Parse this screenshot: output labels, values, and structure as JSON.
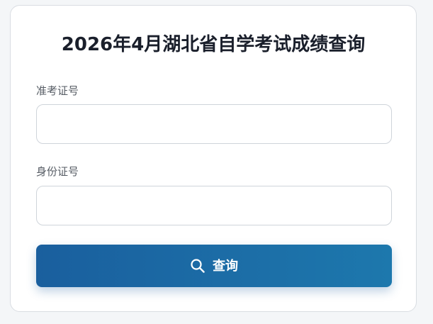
{
  "form": {
    "title": "2026年4月湖北省自学考试成绩查询",
    "fields": [
      {
        "label": "准考证号",
        "value": "",
        "placeholder": ""
      },
      {
        "label": "身份证号",
        "value": "",
        "placeholder": ""
      }
    ],
    "submit": {
      "label": "查询",
      "icon": "search-icon"
    }
  },
  "colors": {
    "button_gradient_start": "#1a5f9e",
    "button_gradient_end": "#1d78ad",
    "title": "#1a1f2b",
    "label": "#555b63",
    "border": "#cfd4da"
  }
}
